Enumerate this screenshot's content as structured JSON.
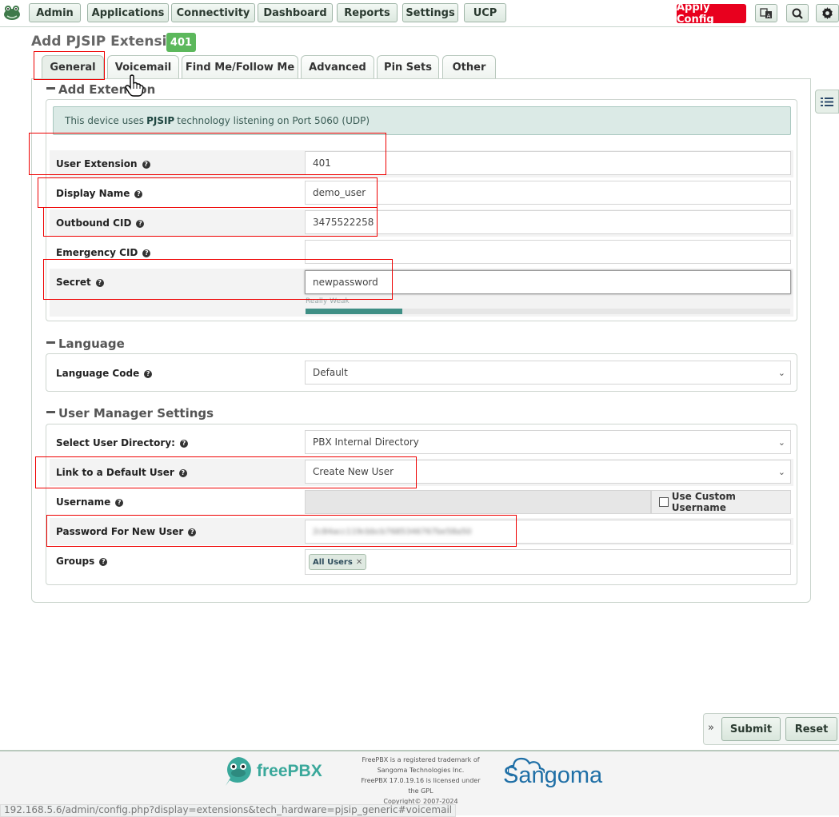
{
  "nav": {
    "items": [
      "Admin",
      "Applications",
      "Connectivity",
      "Dashboard",
      "Reports",
      "Settings",
      "UCP"
    ],
    "apply_config": "Apply Config",
    "icons": [
      "frog-logo-icon",
      "language-icon",
      "search-icon",
      "gear-icon"
    ]
  },
  "page": {
    "title": "Add PJSIP Extension",
    "badge": "401"
  },
  "tabs": [
    "General",
    "Voicemail",
    "Find Me/Follow Me",
    "Advanced",
    "Pin Sets",
    "Other"
  ],
  "sections": {
    "add_extension": "Add Extension",
    "language": "Language",
    "user_manager": "User Manager Settings"
  },
  "info": {
    "prefix": "This device uses",
    "tech": "PJSIP",
    "suffix": "technology listening on Port 5060 (UDP)"
  },
  "fields": {
    "user_extension": {
      "label": "User Extension",
      "value": "401"
    },
    "display_name": {
      "label": "Display Name",
      "value": "demo_user"
    },
    "outbound_cid": {
      "label": "Outbound CID",
      "value": "3475522258"
    },
    "emergency_cid": {
      "label": "Emergency CID",
      "value": ""
    },
    "secret": {
      "label": "Secret",
      "value": "newpassword",
      "strength": "Really Weak",
      "strength_fraction": 0.2
    },
    "language_code": {
      "label": "Language Code",
      "value": "Default"
    },
    "user_directory": {
      "label": "Select User Directory:",
      "value": "PBX Internal Directory"
    },
    "default_user": {
      "label": "Link to a Default User",
      "value": "Create New User"
    },
    "username": {
      "label": "Username",
      "value": "",
      "custom": "Use Custom Username"
    },
    "new_user_password": {
      "label": "Password For New User",
      "value": "2c84acc119cbbcb7685346767be58a50"
    },
    "groups": {
      "label": "Groups",
      "value": "All Users"
    }
  },
  "actions": {
    "submit": "Submit",
    "reset": "Reset"
  },
  "footer": {
    "brand": "freePBX",
    "legal": [
      "FreePBX is a registered trademark of",
      "Sangoma Technologies Inc.",
      "FreePBX 17.0.19.16 is licensed under",
      "the GPL",
      "Copyright© 2007-2024"
    ],
    "sangoma": "Sangoma",
    "status_url": "192.168.5.6/admin/config.php?display=extensions&tech_hardware=pjsip_generic#voicemail"
  },
  "colors": {
    "accent_green": "#5cb85c",
    "apply_red": "#e8001e",
    "highlight_red": "#e00000"
  }
}
